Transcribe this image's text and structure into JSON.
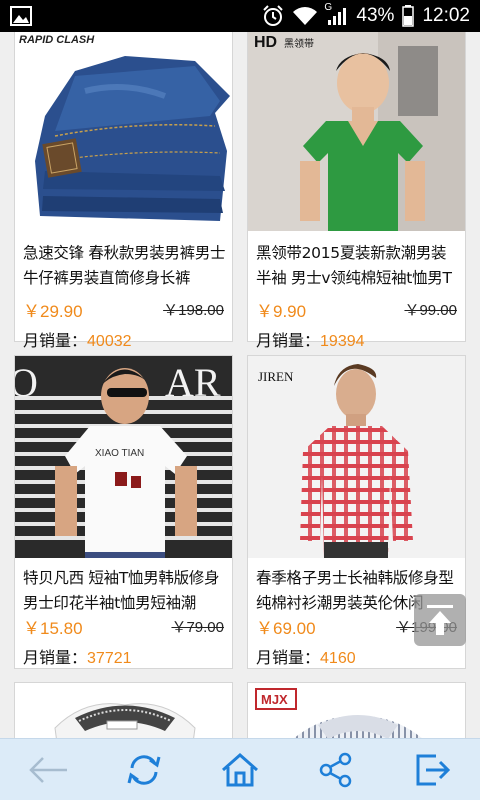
{
  "status_bar": {
    "battery_percent": "43%",
    "time": "12:02",
    "signal_label": "G"
  },
  "products": [
    {
      "brand": "RAPID CLASH",
      "title": "急速交锋 春秋款男装男裤男士牛仔裤男装直筒修身长裤",
      "price": "￥29.90",
      "old_price": "￥198.00",
      "sales_label": "月销量：",
      "sales_count": "40032"
    },
    {
      "brand": "HD",
      "brand_sub": "黑领带",
      "title": "黑领带2015夏装新款潮男装半袖 男士v领纯棉短袖t恤男T",
      "price": "￥9.90",
      "old_price": "￥99.00",
      "sales_label": "月销量：",
      "sales_count": "19394"
    },
    {
      "shirt_text": "XIAO TIAN",
      "title": "特贝凡西 短袖T恤男韩版修身男士印花半袖t恤男短袖潮",
      "price": "￥15.80",
      "old_price": "￥79.00",
      "sales_label": "月销量：",
      "sales_count": "37721"
    },
    {
      "brand": "JIREN",
      "title": "春季格子男士长袖韩版修身型纯棉衬衫潮男装英伦休闲",
      "price": "￥69.00",
      "old_price": "￥199.00",
      "sales_label": "月销量：",
      "sales_count": "4160"
    },
    {
      "title": "",
      "price": "",
      "old_price": ""
    },
    {
      "brand": "MJX",
      "title": "",
      "price": "",
      "old_price": ""
    }
  ],
  "colors": {
    "accent_orange": "#f08a1b",
    "nav_icon_blue": "#1e7fd8",
    "bottom_bar_bg": "#dcebf8"
  },
  "bottom_nav": [
    {
      "icon": "back-arrow-icon"
    },
    {
      "icon": "refresh-icon"
    },
    {
      "icon": "home-icon"
    },
    {
      "icon": "share-icon"
    },
    {
      "icon": "exit-icon"
    }
  ]
}
